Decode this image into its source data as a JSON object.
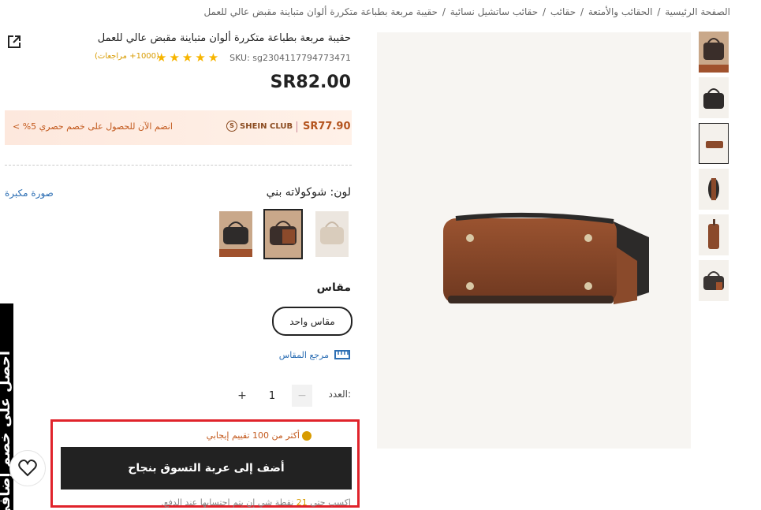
{
  "breadcrumb": [
    "الصفحة الرئيسية",
    "/",
    "الحقائب والأمتعة",
    "/",
    "حقائب",
    "/",
    "حقائب ساتشيل نسائية",
    "/",
    "حقيبة مربعة بطباعة متكررة ألوان متباينة مقبض عالي للعمل"
  ],
  "product": {
    "title": "حقيبة مربعة بطباعة متكررة ألوان متباينة مقبض عالي للعمل",
    "sku": "SKU: sg2304117794773471",
    "stars": "★★★★★",
    "reviews": "(1000+ مراجعات)",
    "price": "SR82.00"
  },
  "club": {
    "text": "انضم الآن للحصول على خصم حصري 5% >",
    "logo": "SHEIN CLUB",
    "price": "SR77.90"
  },
  "color": {
    "label": "لون:  شوكولاته بني",
    "photo_link": "صورة مكبرة"
  },
  "size": {
    "title": "مقاس",
    "option": "مقاس واحد",
    "reference": "مرجع المقاس"
  },
  "quantity": {
    "label": "العدد:",
    "value": "1",
    "minus": "−",
    "plus": "+"
  },
  "cart": {
    "reviews_note": "أكثر من 100 تقييم إيجابي",
    "button": "أضف إلى عربة التسوق بنجاح",
    "points_prefix": "اكسب حتى",
    "points_value": "21",
    "points_suffix": "نقطة شي إن يتم احتسابها عند الدفع."
  },
  "side_tab": "احصل على خصم إضافي",
  "icons": {
    "share": "share-external-icon",
    "heart": "heart-icon",
    "ruler": "ruler-icon",
    "thumb_up": "thumb-up-icon"
  },
  "colors": {
    "accent": "#c35a1e",
    "link": "#2d6fb4",
    "star": "#f7b500",
    "highlight": "#e0232b"
  }
}
